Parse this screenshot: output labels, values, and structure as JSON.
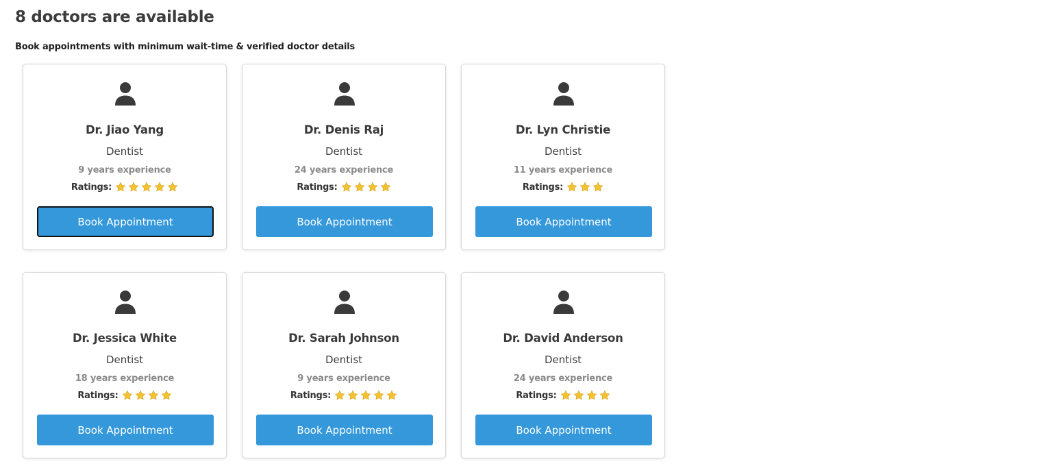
{
  "header": {
    "title": "8 doctors are available",
    "subtitle": "Book appointments with minimum wait-time & verified doctor details"
  },
  "colors": {
    "button": "#3498db",
    "star": "#f2c230",
    "avatar": "#3a3a3a"
  },
  "ratings_label": "Ratings:",
  "book_label": "Book Appointment",
  "doctors": [
    {
      "name": "Dr. Jiao Yang",
      "specialty": "Dentist",
      "experience": "9 years experience",
      "stars": 5,
      "focused": true
    },
    {
      "name": "Dr. Denis Raj",
      "specialty": "Dentist",
      "experience": "24 years experience",
      "stars": 4,
      "focused": false
    },
    {
      "name": "Dr. Lyn Christie",
      "specialty": "Dentist",
      "experience": "11 years experience",
      "stars": 3,
      "focused": false
    },
    {
      "name": "Dr. Jessica White",
      "specialty": "Dentist",
      "experience": "18 years experience",
      "stars": 4,
      "focused": false
    },
    {
      "name": "Dr. Sarah Johnson",
      "specialty": "Dentist",
      "experience": "9 years experience",
      "stars": 5,
      "focused": false
    },
    {
      "name": "Dr. David Anderson",
      "specialty": "Dentist",
      "experience": "24 years experience",
      "stars": 4,
      "focused": false
    }
  ]
}
